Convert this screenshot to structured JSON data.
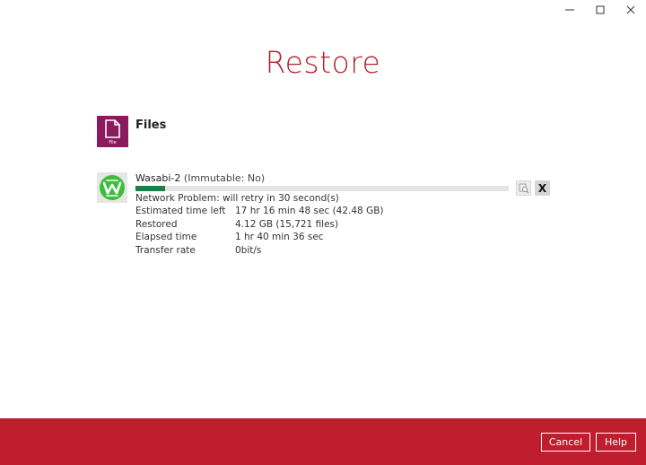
{
  "window": {
    "controls": [
      "minimize-icon",
      "maximize-icon",
      "close-icon"
    ]
  },
  "page": {
    "title": "Restore"
  },
  "source": {
    "label": "Files",
    "icon_caption": "File",
    "icon": "file-icon",
    "icon_color": "#8b1a5f"
  },
  "destination": {
    "name": "Wasabi-2",
    "sub": "(Immutable: No)",
    "icon": "wasabi-logo-icon",
    "brand_color": "#3bbf3b",
    "progress_fraction": 0.08,
    "status": "Network Problem: will retry in 30 second(s)",
    "details": [
      {
        "key": "Estimated time left",
        "value": "17 hr 16 min 48 sec (42.48 GB)"
      },
      {
        "key": "Restored",
        "value": "4.12 GB (15,721 files)"
      },
      {
        "key": "Elapsed time",
        "value": "1 hr 40 min 36 sec"
      },
      {
        "key": "Transfer rate",
        "value": "0bit/s"
      }
    ]
  },
  "actions": {
    "view_icon": "magnifier-icon",
    "remove_label": "X"
  },
  "footer": {
    "cancel_label": "Cancel",
    "help_label": "Help",
    "bg_color": "#be1e2d"
  }
}
